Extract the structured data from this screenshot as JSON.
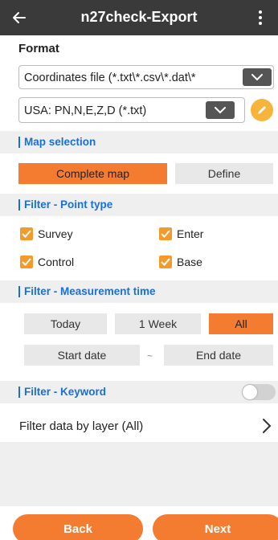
{
  "header": {
    "title": "n27check-Export",
    "back_icon": "arrow-left-icon",
    "more_icon": "more-vertical-icon"
  },
  "format": {
    "label": "Format",
    "file_type": "Coordinates file (*.txt\\*.csv\\*.dat\\*",
    "layout": "USA: PN,N,E,Z,D (*.txt)",
    "edit_icon": "pencil-icon"
  },
  "map_selection": {
    "title": "Map selection",
    "options": [
      "Complete map",
      "Define"
    ],
    "selected": "Complete map"
  },
  "point_type": {
    "title": "Filter - Point type",
    "items": [
      {
        "label": "Survey",
        "checked": true
      },
      {
        "label": "Enter",
        "checked": true
      },
      {
        "label": "Control",
        "checked": true
      },
      {
        "label": "Base",
        "checked": true
      }
    ]
  },
  "measurement_time": {
    "title": "Filter - Measurement time",
    "ranges": [
      "Today",
      "1 Week",
      "All"
    ],
    "selected": "All",
    "start_date": "Start date",
    "separator": "~",
    "end_date": "End date"
  },
  "keyword": {
    "title": "Filter - Keyword",
    "enabled": false
  },
  "layer_filter": {
    "label": "Filter data by layer (All)"
  },
  "footer": {
    "back": "Back",
    "next": "Next"
  },
  "colors": {
    "accent": "#f47c30",
    "section_text": "#1a6fd8",
    "topbar": "#3a3a3a",
    "checkbox": "#f39a2b",
    "edit_button": "#f7b43b"
  }
}
